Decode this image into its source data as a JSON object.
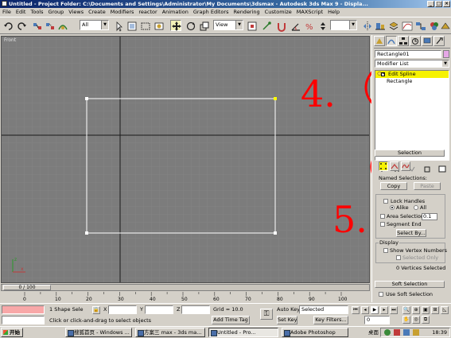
{
  "window": {
    "title": "Untitled    - Project Folder: C:\\Documents and Settings\\Administrator\\My Documents\\3dsmax    - Autodesk 3ds Max 9    - Displa...",
    "buttons": [
      "_",
      "□",
      "×"
    ]
  },
  "menu": [
    "File",
    "Edit",
    "Tools",
    "Group",
    "Views",
    "Create",
    "Modifiers",
    "reactor",
    "Animation",
    "Graph Editors",
    "Rendering",
    "Customize",
    "MAXScript",
    "Help"
  ],
  "toolbar": {
    "selection_filter": "All",
    "ref_coord": "View",
    "icons": [
      "undo-icon",
      "redo-icon",
      "select-link-icon",
      "unlink-icon",
      "bind-spacewarp-icon",
      "selection-filter",
      "select-object-icon",
      "select-by-name-icon",
      "rect-region-icon",
      "window-crossing-icon",
      "select-move-icon",
      "select-rotate-icon",
      "select-scale-icon",
      "ref-coord",
      "pivot-icon",
      "manipulate-icon",
      "snaps-icon",
      "angle-snap-icon",
      "percent-snap-icon",
      "spinner-snap-icon",
      "named-selection",
      "mirror-icon",
      "align-icon",
      "layer-icon",
      "curve-editor-icon",
      "schematic-icon",
      "material-editor-icon",
      "render-setup-icon",
      "quick-render-icon"
    ]
  },
  "viewport": {
    "label": "Front",
    "background": "#7c7c7c",
    "shape_color": "#ffffff",
    "selected_vertex_color": "#ffff00",
    "annotations": [
      "4.",
      "5."
    ],
    "annotation_color": "#ff0000"
  },
  "command_panel": {
    "object_name": "Rectangle01",
    "object_color": "#e6a8e6",
    "modifier_list": "Modifier List",
    "stack": [
      {
        "label": "Edit Spline",
        "selected": true
      },
      {
        "label": "Rectangle",
        "selected": false
      }
    ],
    "selection": {
      "title": "Selection",
      "named_selections": "Named Selections:",
      "copy": "Copy",
      "paste": "Paste",
      "lock_handles": "Lock Handles",
      "alike": "Alike",
      "all": "All",
      "area_selection": "Area Selection:",
      "area_value": "0.1",
      "segment_end": "Segment End",
      "select_by": "Select By...",
      "display": "Display",
      "show_vertex_numbers": "Show Vertex Numbers",
      "selected_only": "Selected Only",
      "status": "0 Vertices Selected"
    },
    "soft_selection": {
      "title": "Soft Selection",
      "use_soft_selection": "Use Soft Selection"
    }
  },
  "time": {
    "slider": "0 / 100",
    "ticks": [
      "0",
      "10",
      "20",
      "30",
      "40",
      "50",
      "60",
      "70",
      "80",
      "90",
      "100"
    ]
  },
  "status": {
    "selection_info": "1 Shape Sele",
    "prompt": "Click or click-and-drag to select objects",
    "x_label": "X",
    "y_label": "Y",
    "z_label": "Z",
    "grid": "Grid = 10.0",
    "add_time_tag": "Add Time Tag",
    "auto_key": "Auto Key",
    "selected": "Selected",
    "set_key": "Set Key",
    "key_filters": "Key Filters...",
    "frame": "0"
  },
  "taskbar": {
    "start": "开始",
    "tasks": [
      "搜狐首页 - Windows ...",
      "方案三 max - 3ds ma...",
      "Untitled    - Pro...",
      "Adobe Photoshop"
    ],
    "active_task": 2,
    "tray_label": "桌面",
    "time": "18:39"
  }
}
